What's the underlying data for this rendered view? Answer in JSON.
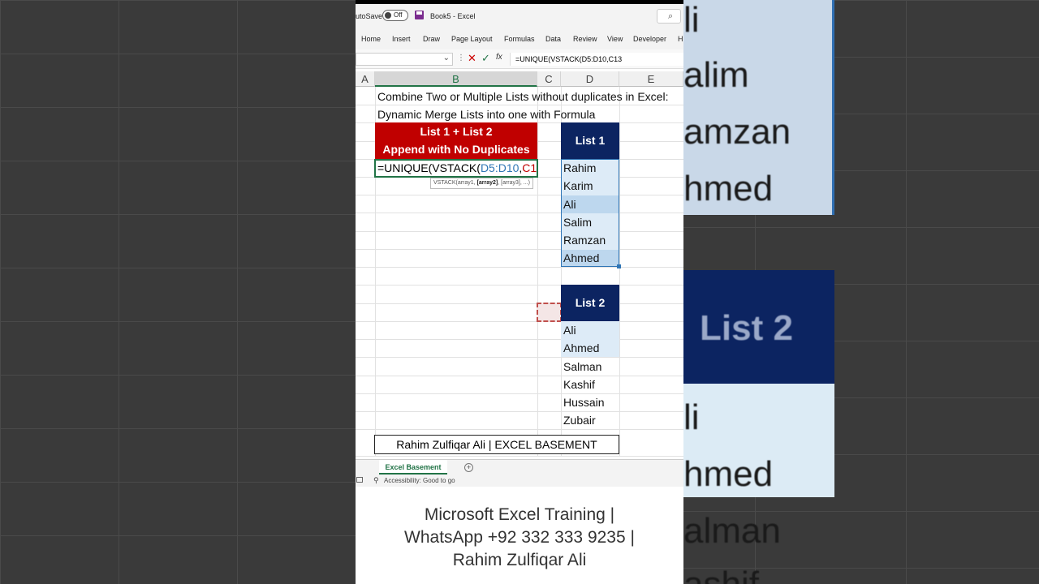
{
  "window": {
    "autosave_label": "utoSave",
    "autosave_state": "Off",
    "title": "Book5 - Excel"
  },
  "ribbon": {
    "tabs": [
      "Home",
      "Insert",
      "Draw",
      "Page Layout",
      "Formulas",
      "Data",
      "Review",
      "View",
      "Developer",
      "H"
    ]
  },
  "formula_bar": {
    "formula": "=UNIQUE(VSTACK(D5:D10,C13"
  },
  "columns": [
    "A",
    "B",
    "C",
    "D",
    "E"
  ],
  "sheet": {
    "heading_line1": "Combine Two or Multiple Lists without duplicates in Excel:",
    "heading_line2": "Dynamic Merge Lists into one with Formula",
    "result_header_line1": "List 1 + List 2",
    "result_header_line2": "Append with No Duplicates",
    "edit_cell": {
      "part1": "=UNIQUE(VSTACK(",
      "part2": "D5:D10",
      "part3": ",",
      "part4": "C13"
    },
    "tooltip": {
      "pre": "VSTACK(array1, ",
      "bold": "[array2]",
      "post": ", [array3], ...)"
    },
    "list1_header": "List 1",
    "list1": [
      "Rahim",
      "Karim",
      "Ali",
      "Salim",
      "Ramzan",
      "Ahmed"
    ],
    "list2_header": "List 2",
    "list2": [
      "Ali",
      "Ahmed",
      "Salman",
      "Kashif",
      "Hussain",
      "Zubair"
    ],
    "footer_box": "Rahim Zulfiqar Ali | EXCEL BASEMENT"
  },
  "sheet_tab": "Excel Basement",
  "status": "Accessibility: Good to go",
  "caption": {
    "line1": "Microsoft Excel Training |",
    "line2": "WhatsApp +92 332 333 9235 |",
    "line3": "Rahim Zulfiqar Ali"
  },
  "background": {
    "names": [
      "li",
      "alim",
      "amzan",
      "hmed",
      "List 2",
      "li",
      "hmed",
      "alman",
      "ashif"
    ]
  },
  "colors": {
    "red_header": "#c00000",
    "navy_header": "#0c2461",
    "light_blue": "#ddebf7",
    "selected_blue": "#bdd7ee",
    "excel_green": "#217346"
  }
}
